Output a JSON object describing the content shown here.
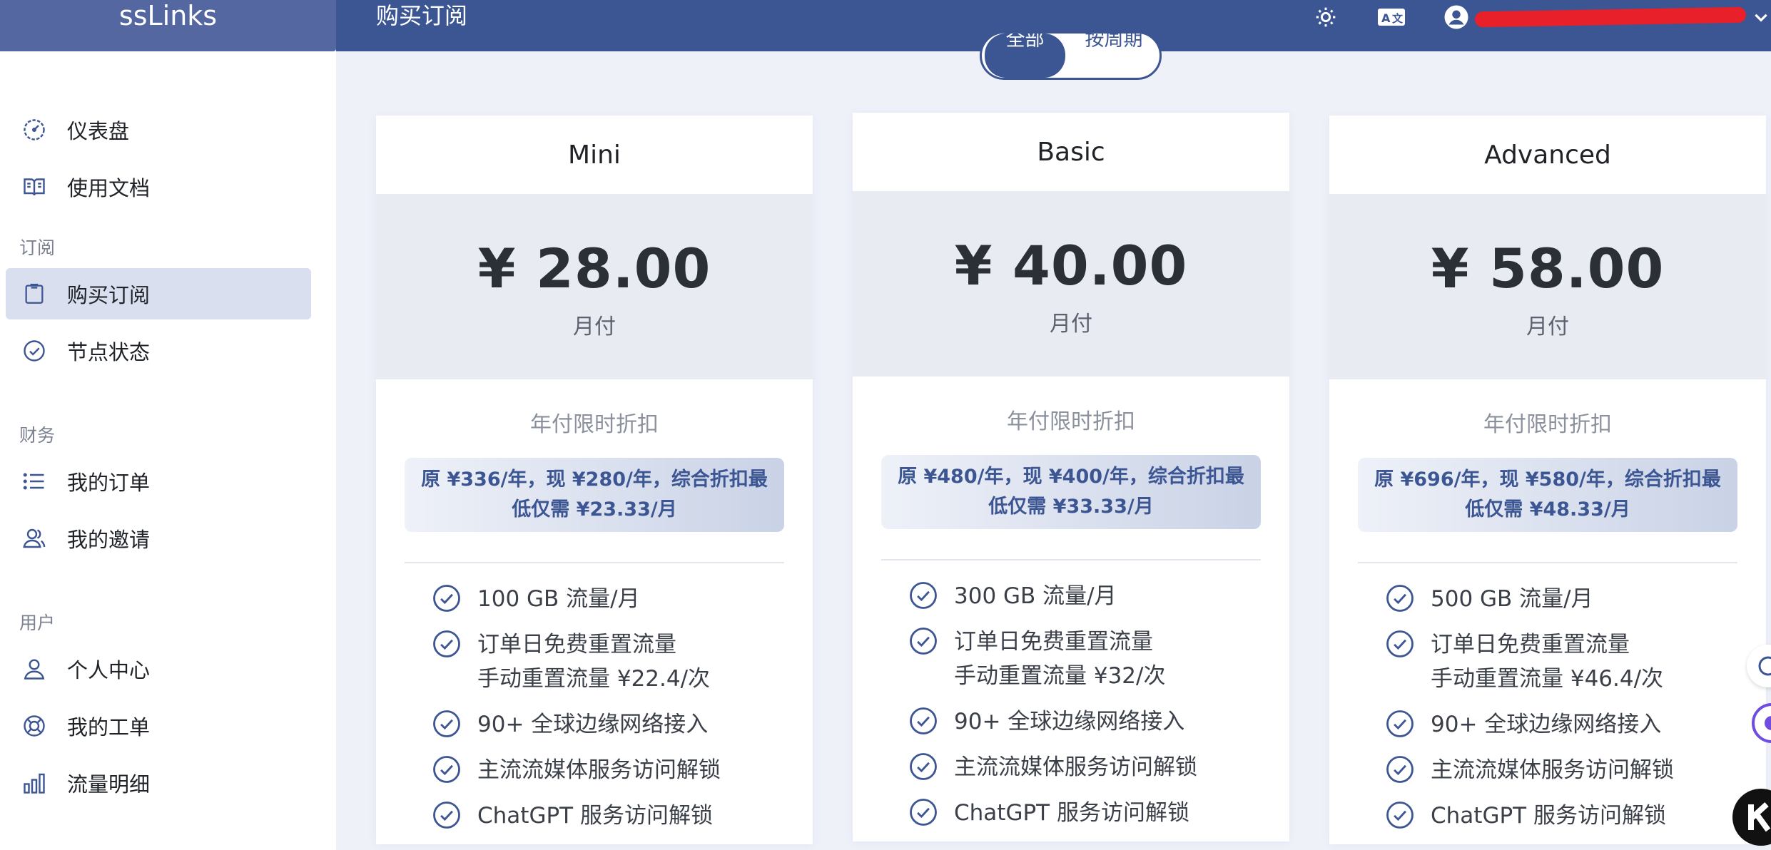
{
  "brand": "ssLinks",
  "header": {
    "title": "购买订阅"
  },
  "sidebar": {
    "top_items": [
      {
        "label": "仪表盘",
        "icon": "gauge-icon"
      },
      {
        "label": "使用文档",
        "icon": "book-icon"
      }
    ],
    "sections": [
      {
        "label": "订阅",
        "items": [
          {
            "label": "购买订阅",
            "icon": "clipboard-icon",
            "active": true
          },
          {
            "label": "节点状态",
            "icon": "check-circle-icon"
          }
        ]
      },
      {
        "label": "财务",
        "items": [
          {
            "label": "我的订单",
            "icon": "list-icon"
          },
          {
            "label": "我的邀请",
            "icon": "users-icon"
          }
        ]
      },
      {
        "label": "用户",
        "items": [
          {
            "label": "个人中心",
            "icon": "user-icon"
          },
          {
            "label": "我的工单",
            "icon": "lifebuoy-icon"
          },
          {
            "label": "流量明细",
            "icon": "bar-chart-icon"
          }
        ]
      }
    ]
  },
  "filter": {
    "options": [
      "全部",
      "按周期"
    ],
    "selected": "全部"
  },
  "plans": [
    {
      "name": "Mini",
      "price": "¥ 28.00",
      "period": "月付",
      "promo_title": "年付限时折扣",
      "promo_line1": "原 ¥336/年，现 ¥280/年，综合折扣最",
      "promo_line2": "低仅需 ¥23.33/月",
      "features": [
        "100 GB 流量/月",
        "订单日免费重置流量",
        "手动重置流量 ¥22.4/次",
        "90+ 全球边缘网络接入",
        "主流流媒体服务访问解锁",
        "ChatGPT 服务访问解锁"
      ]
    },
    {
      "name": "Basic",
      "price": "¥ 40.00",
      "period": "月付",
      "promo_title": "年付限时折扣",
      "promo_line1": "原 ¥480/年，现 ¥400/年，综合折扣最",
      "promo_line2": "低仅需 ¥33.33/月",
      "features": [
        "300 GB 流量/月",
        "订单日免费重置流量",
        "手动重置流量 ¥32/次",
        "90+ 全球边缘网络接入",
        "主流流媒体服务访问解锁",
        "ChatGPT 服务访问解锁"
      ]
    },
    {
      "name": "Advanced",
      "price": "¥ 58.00",
      "period": "月付",
      "promo_title": "年付限时折扣",
      "promo_line1": "原 ¥696/年，现 ¥580/年，综合折扣最",
      "promo_line2": "低仅需 ¥48.33/月",
      "features": [
        "500 GB 流量/月",
        "订单日免费重置流量",
        "手动重置流量 ¥46.4/次",
        "90+ 全球边缘网络接入",
        "主流流媒体服务访问解锁",
        "ChatGPT 服务访问解锁"
      ]
    }
  ],
  "colors": {
    "primary": "#3c5593",
    "brand_bg": "#5567a1",
    "page_bg": "#eef1f8",
    "redaction": "#e8202a"
  }
}
